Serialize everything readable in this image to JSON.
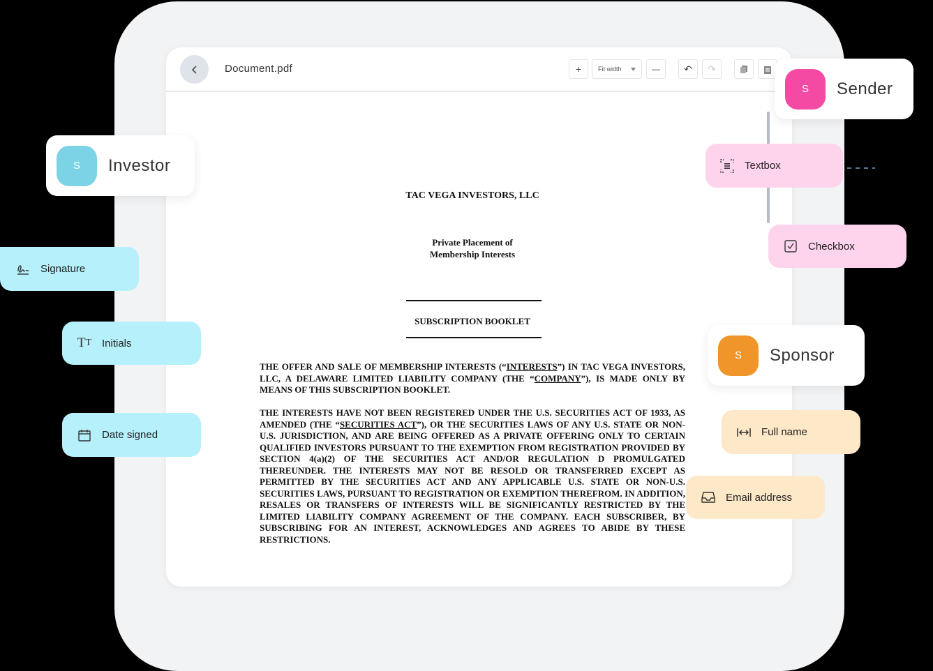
{
  "viewer": {
    "filename": "Document.pdf",
    "zoom_in": "+",
    "zoom_select": "Fit width",
    "zoom_out": "—",
    "undo": "↶",
    "redo": "↷"
  },
  "document": {
    "title": "TAC VEGA INVESTORS, LLC",
    "subtitle_1": "Private Placement of",
    "subtitle_2": "Membership Interests",
    "booklet": "SUBSCRIPTION BOOKLET",
    "para1_a": "THE OFFER AND SALE OF MEMBERSHIP INTERESTS (“",
    "para1_u1": "INTERESTS",
    "para1_b": "”) IN TAC VEGA INVESTORS, LLC, A DELAWARE LIMITED LIABILITY COMPANY (THE “",
    "para1_u2": "COMPANY",
    "para1_c": "”), IS MADE ONLY BY MEANS OF THIS SUBSCRIPTION BOOKLET.",
    "para2_a": "THE INTERESTS HAVE NOT BEEN REGISTERED UNDER THE U.S. SECURITIES ACT OF 1933, AS AMENDED (THE “",
    "para2_u1": "SECURITIES ACT",
    "para2_b": "”), OR THE SECURITIES LAWS OF ANY U.S. STATE OR NON-U.S. JURISDICTION, AND ARE BEING OFFERED AS A PRIVATE OFFERING ONLY TO CERTAIN QUALIFIED INVESTORS PURSUANT TO THE EXEMPTION FROM REGISTRATION PROVIDED BY SECTION 4(a)(2) OF THE SECURITIES ACT AND/OR REGULATION D PROMULGATED THEREUNDER. THE INTERESTS MAY NOT BE RESOLD OR TRANSFERRED EXCEPT AS PERMITTED BY THE SECURITIES ACT AND ANY APPLICABLE U.S. STATE OR NON-U.S. SECURITIES LAWS, PURSUANT TO REGISTRATION OR EXEMPTION THEREFROM. IN ADDITION, RESALES OR TRANSFERS OF INTERESTS WILL BE SIGNIFICANTLY RESTRICTED BY THE LIMITED LIABILITY COMPANY AGREEMENT OF THE COMPANY. EACH SUBSCRIBER, BY SUBSCRIBING FOR AN INTEREST, ACKNOWLEDGES AND AGREES TO ABIDE BY THESE RESTRICTIONS."
  },
  "roles": {
    "investor": {
      "initial": "S",
      "label": "Investor",
      "color": "#7dd3e6"
    },
    "sender": {
      "initial": "S",
      "label": "Sender",
      "color": "#f54aa3"
    },
    "sponsor": {
      "initial": "S",
      "label": "Sponsor",
      "color": "#f0952a"
    }
  },
  "fields": {
    "signature": {
      "label": "Signature",
      "icon": "signature-icon",
      "color": "#b5f0fb"
    },
    "initials": {
      "label": "Initials",
      "icon": "text-size-icon",
      "color": "#b5f0fb"
    },
    "date_signed": {
      "label": "Date signed",
      "icon": "calendar-icon",
      "color": "#b5f0fb"
    },
    "textbox": {
      "label": "Textbox",
      "icon": "textbox-icon",
      "color": "#fdd4ec"
    },
    "checkbox": {
      "label": "Checkbox",
      "icon": "checkbox-icon",
      "color": "#fdd4ec"
    },
    "full_name": {
      "label": "Full name",
      "icon": "width-arrows-icon",
      "color": "#fde8c8"
    },
    "email": {
      "label": "Email address",
      "icon": "inbox-icon",
      "color": "#fde8c8"
    }
  }
}
